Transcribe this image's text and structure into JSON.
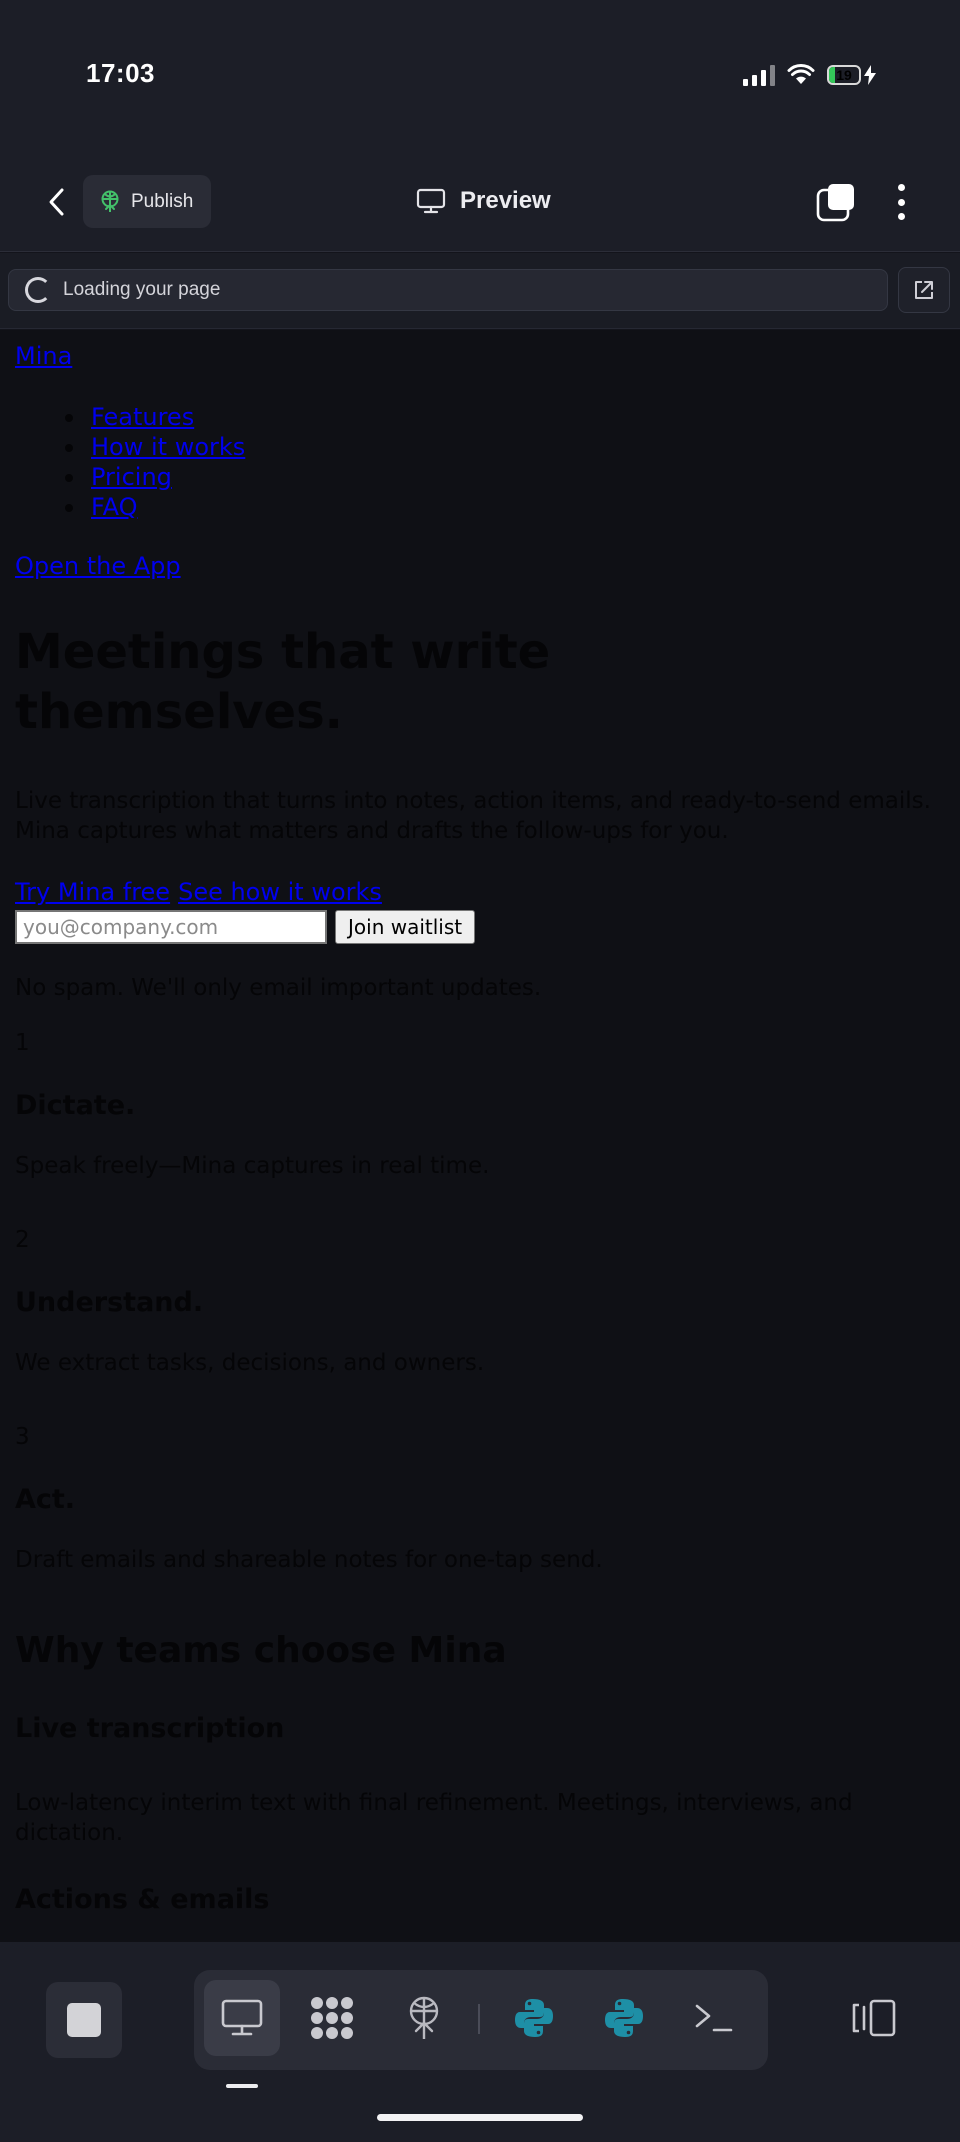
{
  "status_bar": {
    "time": "17:03",
    "battery": "19",
    "battery_level": 0.19
  },
  "toolbar": {
    "publish_label": "Publish",
    "preview_label": "Preview"
  },
  "url_bar": {
    "status_text": "Loading your page"
  },
  "page": {
    "brand": "Mina",
    "nav": [
      "Features",
      "How it works",
      "Pricing",
      "FAQ"
    ],
    "open_app": "Open the App",
    "hero_title": "Meetings that write themselves.",
    "hero_subtitle": "Live transcription that turns into notes, action items, and ready-to-send emails. Mina captures what matters and drafts the follow-ups for you.",
    "cta_primary": "Try Mina free",
    "cta_secondary": "See how it works",
    "email_placeholder": "you@company.com",
    "join_label": "Join waitlist",
    "no_spam": "No spam. We'll only email important updates.",
    "steps": [
      {
        "num": "1",
        "title": "Dictate.",
        "desc": "Speak freely—Mina captures in real time."
      },
      {
        "num": "2",
        "title": "Understand.",
        "desc": "We extract tasks, decisions, and owners."
      },
      {
        "num": "3",
        "title": "Act.",
        "desc": "Draft emails and shareable notes for one-tap send."
      }
    ],
    "why_title": "Why teams choose Mina",
    "features": [
      {
        "title": "Live transcription",
        "desc": "Low-latency interim text with final refinement. Meetings, interviews, and dictation."
      },
      {
        "title": "Actions & emails"
      }
    ]
  },
  "dock": {
    "items": [
      "desktop-icon",
      "apps-grid-icon",
      "deploy-icon",
      "python-icon",
      "python-icon",
      "terminal-icon"
    ],
    "accent": "#1e8fa6"
  }
}
